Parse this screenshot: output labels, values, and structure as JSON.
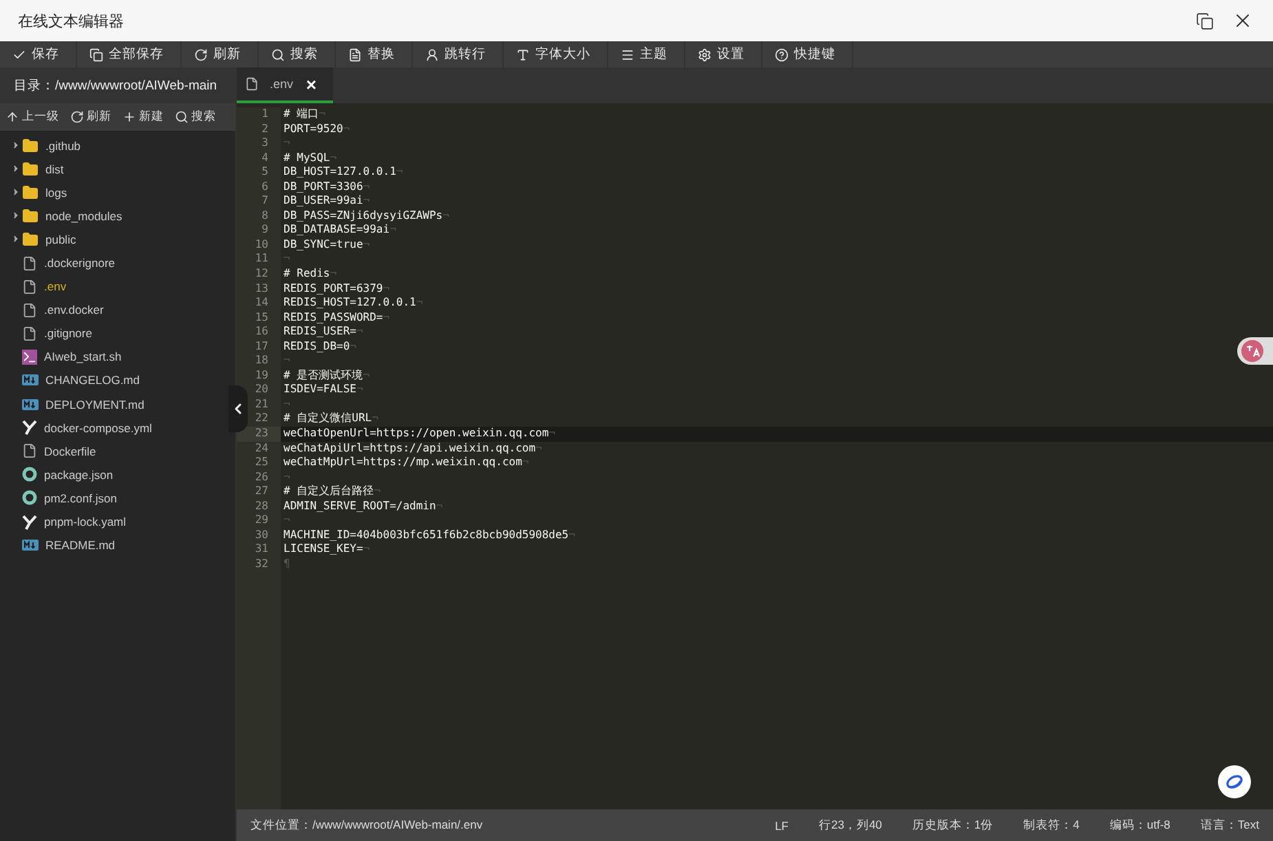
{
  "window": {
    "title": "在线文本编辑器"
  },
  "toolbar": [
    {
      "kind": "check",
      "label": "保存"
    },
    {
      "kind": "copy",
      "label": "全部保存"
    },
    {
      "kind": "refresh",
      "label": "刷新"
    },
    {
      "kind": "search",
      "label": "搜索"
    },
    {
      "kind": "replace",
      "label": "替换"
    },
    {
      "kind": "jump",
      "label": "跳转行"
    },
    {
      "kind": "font",
      "label": "字体大小"
    },
    {
      "kind": "menu",
      "label": "主题"
    },
    {
      "kind": "gear",
      "label": "设置"
    },
    {
      "kind": "help",
      "label": "快捷键"
    }
  ],
  "sidebar": {
    "directory": "目录：/www/wwwroot/AIWeb-main",
    "actions": [
      {
        "kind": "up",
        "label": "上一级"
      },
      {
        "kind": "refresh",
        "label": "刷新"
      },
      {
        "kind": "plus",
        "label": "新建"
      },
      {
        "kind": "search",
        "label": "搜索"
      }
    ],
    "items": [
      {
        "kind": "folder",
        "name": ".github",
        "expanded": false,
        "selected": false
      },
      {
        "kind": "folder",
        "name": "dist",
        "expanded": false,
        "selected": false
      },
      {
        "kind": "folder",
        "name": "logs",
        "expanded": false,
        "selected": false
      },
      {
        "kind": "folder",
        "name": "node_modules",
        "expanded": false,
        "selected": false
      },
      {
        "kind": "folder",
        "name": "public",
        "expanded": false,
        "selected": false
      },
      {
        "kind": "text",
        "name": ".dockerignore",
        "selected": false
      },
      {
        "kind": "text",
        "name": ".env",
        "selected": true
      },
      {
        "kind": "text",
        "name": ".env.docker",
        "selected": false
      },
      {
        "kind": "text",
        "name": ".gitignore",
        "selected": false
      },
      {
        "kind": "shell",
        "name": "AIweb_start.sh",
        "selected": false
      },
      {
        "kind": "markdown",
        "name": "CHANGELOG.md",
        "selected": false
      },
      {
        "kind": "markdown",
        "name": "DEPLOYMENT.md",
        "selected": false
      },
      {
        "kind": "yaml",
        "name": "docker-compose.yml",
        "selected": false
      },
      {
        "kind": "text",
        "name": "Dockerfile",
        "selected": false
      },
      {
        "kind": "json",
        "name": "package.json",
        "selected": false
      },
      {
        "kind": "json",
        "name": "pm2.conf.json",
        "selected": false
      },
      {
        "kind": "yaml",
        "name": "pnpm-lock.yaml",
        "selected": false
      },
      {
        "kind": "markdown",
        "name": "README.md",
        "selected": false
      }
    ]
  },
  "tabs": [
    {
      "label": ".env",
      "selected": true,
      "close": "×"
    }
  ],
  "editor": {
    "lines": [
      {
        "number": "1",
        "text": "# 端口",
        "eol": "¬",
        "current": false
      },
      {
        "number": "2",
        "text": "PORT=9520",
        "eol": "¬",
        "current": false
      },
      {
        "number": "3",
        "eol": "¬",
        "current": false
      },
      {
        "number": "4",
        "text": "# MySQL",
        "eol": "¬",
        "current": false
      },
      {
        "number": "5",
        "text": "DB_HOST=127.0.0.1",
        "eol": "¬",
        "current": false
      },
      {
        "number": "6",
        "text": "DB_PORT=3306",
        "eol": "¬",
        "current": false
      },
      {
        "number": "7",
        "text": "DB_USER=99ai",
        "eol": "¬",
        "current": false
      },
      {
        "number": "8",
        "text": "DB_PASS=ZNji6dysyiGZAWPs",
        "eol": "¬",
        "current": false
      },
      {
        "number": "9",
        "text": "DB_DATABASE=99ai",
        "eol": "¬",
        "current": false
      },
      {
        "number": "10",
        "text": "DB_SYNC=true",
        "eol": "¬",
        "current": false
      },
      {
        "number": "11",
        "eol": "¬",
        "current": false
      },
      {
        "number": "12",
        "text": "# Redis",
        "eol": "¬",
        "current": false
      },
      {
        "number": "13",
        "text": "REDIS_PORT=6379",
        "eol": "¬",
        "current": false
      },
      {
        "number": "14",
        "text": "REDIS_HOST=127.0.0.1",
        "eol": "¬",
        "current": false
      },
      {
        "number": "15",
        "text": "REDIS_PASSWORD=",
        "eol": "¬",
        "current": false
      },
      {
        "number": "16",
        "text": "REDIS_USER=",
        "eol": "¬",
        "current": false
      },
      {
        "number": "17",
        "text": "REDIS_DB=0",
        "eol": "¬",
        "current": false
      },
      {
        "number": "18",
        "eol": "¬",
        "current": false
      },
      {
        "number": "19",
        "text": "# 是否测试环境",
        "eol": "¬",
        "current": false
      },
      {
        "number": "20",
        "text": "ISDEV=FALSE",
        "eol": "¬",
        "current": false
      },
      {
        "number": "21",
        "eol": "¬",
        "current": false
      },
      {
        "number": "22",
        "text": "# 自定义微信URL",
        "eol": "¬",
        "current": false
      },
      {
        "number": "23",
        "text": "weChatOpenUrl=https://open.weixin.qq.com",
        "eol": "¬",
        "current": true
      },
      {
        "number": "24",
        "text": "weChatApiUrl=https://api.weixin.qq.com",
        "eol": "¬",
        "current": false
      },
      {
        "number": "25",
        "text": "weChatMpUrl=https://mp.weixin.qq.com",
        "eol": "¬",
        "current": false
      },
      {
        "number": "26",
        "eol": "¬",
        "current": false
      },
      {
        "number": "27",
        "text": "# 自定义后台路径",
        "eol": "¬",
        "current": false
      },
      {
        "number": "28",
        "text": "ADMIN_SERVE_ROOT=/admin",
        "eol": "¬",
        "current": false
      },
      {
        "number": "29",
        "eol": "¬",
        "current": false
      },
      {
        "number": "30",
        "text": "MACHINE_ID=404b003bfc651f6b2c8bcb90d5908de5",
        "eol": "¬",
        "current": false
      },
      {
        "number": "31",
        "text": "LICENSE_KEY=",
        "eol": "¬",
        "current": false
      },
      {
        "number": "32",
        "eol": "¶",
        "current": false
      }
    ]
  },
  "status_bar": {
    "path": "文件位置：/www/wwwroot/AIWeb-main/.env",
    "items": [
      "LF",
      "行23，列40",
      "历史版本：1份",
      "制表符：4",
      "编码：utf-8",
      "语言：Text"
    ]
  }
}
